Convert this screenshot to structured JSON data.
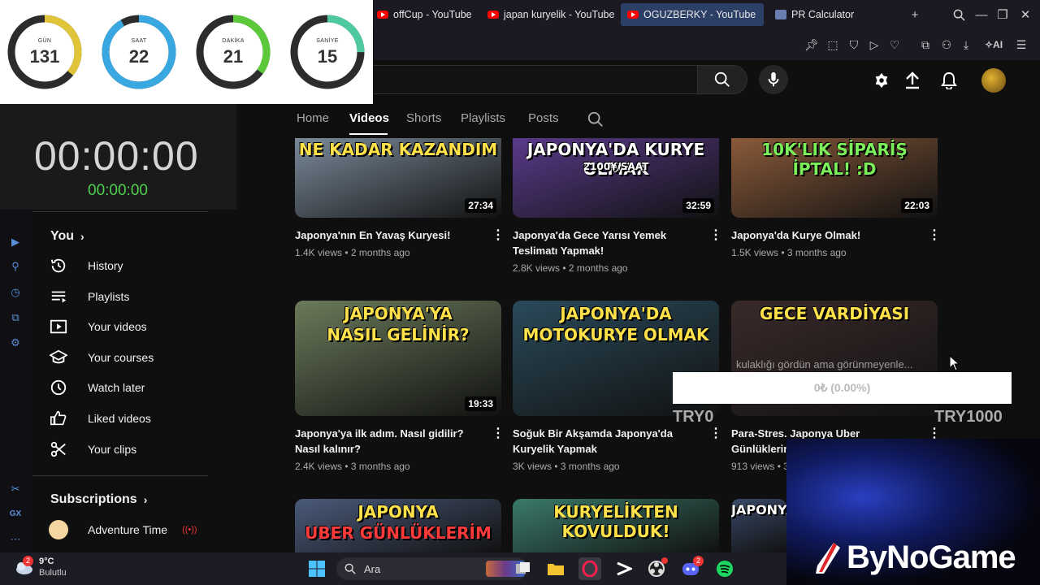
{
  "browser": {
    "tabs": [
      {
        "label": "offCup - YouTube",
        "active": false
      },
      {
        "label": "japan kuryelik - YouTube",
        "active": false
      },
      {
        "label": "OGUZBERKY - YouTube",
        "active": true
      },
      {
        "label": "PR Calculator",
        "active": false
      }
    ],
    "toolbar_ai_label": "AI"
  },
  "countdown": {
    "days": {
      "label": "GÜN",
      "value": "131",
      "color": "#e0c53a"
    },
    "hours": {
      "label": "SAAT",
      "value": "22",
      "color": "#3aa8e0"
    },
    "minutes": {
      "label": "DAKİKA",
      "value": "21",
      "color": "#5cc93a"
    },
    "seconds": {
      "label": "SANİYE",
      "value": "15",
      "color": "#4fc9a0"
    }
  },
  "stopwatch": {
    "main": "00:00:00",
    "sub": "00:00:00"
  },
  "channel_tabs": [
    "Home",
    "Videos",
    "Shorts",
    "Playlists",
    "Posts"
  ],
  "active_channel_tab": "Videos",
  "sidebar": {
    "you_label": "You",
    "items": [
      {
        "label": "History",
        "icon": "history-icon"
      },
      {
        "label": "Playlists",
        "icon": "playlists-icon"
      },
      {
        "label": "Your videos",
        "icon": "your-videos-icon"
      },
      {
        "label": "Your courses",
        "icon": "courses-icon"
      },
      {
        "label": "Watch later",
        "icon": "watch-later-icon"
      },
      {
        "label": "Liked videos",
        "icon": "like-icon"
      },
      {
        "label": "Your clips",
        "icon": "scissors-icon"
      }
    ],
    "subscriptions_label": "Subscriptions",
    "subscription": "Adventure Time",
    "rail_text": "GX"
  },
  "videos": [
    {
      "title": "Japonya'nın En Yavaş Kuryesi!",
      "meta": "1.4K views • 2 months ago",
      "duration": "27:34",
      "thumb_text": "NE KADAR KAZANDIM",
      "thumb_text_color": "#ffe14a",
      "bg": "#7a8a9a"
    },
    {
      "title": "Japonya'da Gece Yarısı Yemek Teslimatı Yapmak!",
      "meta": "2.8K views • 2 months ago",
      "duration": "32:59",
      "thumb_text": "JAPONYA'DA KURYE OLMAK",
      "thumb_text2": "2100¥/SAAT",
      "thumb_text_color": "#ffffff",
      "bg": "#5a3a8a"
    },
    {
      "title": "Japonya'da Kurye Olmak!",
      "meta": "1.5K views • 3 months ago",
      "duration": "22:03",
      "thumb_text": "10K'LIK SİPARİŞ İPTAL! :D",
      "thumb_text_color": "#7cf05a",
      "bg": "#8a5a3a"
    },
    {
      "title": "Japonya'ya ilk adım. Nasıl gidilir? Nasıl kalınır?",
      "meta": "2.4K views • 3 months ago",
      "duration": "19:33",
      "thumb_text": "JAPONYA'YA",
      "thumb_text2": "NASIL GELİNİR?",
      "thumb_text_color": "#ffe14a",
      "bg": "#6a7a5a"
    },
    {
      "title": "Soğuk Bir Akşamda Japonya'da Kuryelik Yapmak",
      "meta": "3K views • 3 months ago",
      "duration": "",
      "thumb_text": "JAPONYA'DA",
      "thumb_text2": "MOTOKURYE OLMAK",
      "thumb_text_color": "#ffe14a",
      "bg": "#2a4a5a"
    },
    {
      "title": "Para-Stres. Japonya Uber Günlüklerim",
      "meta": "913 views • 3",
      "duration": "",
      "thumb_text": "GECE VARDİYASI",
      "thumb_text_color": "#ffe14a",
      "bg": "#3a2a2a"
    },
    {
      "title": "",
      "meta": "",
      "duration": "",
      "thumb_text": "JAPONYA",
      "thumb_text2": "UBER GÜNLÜKLERİM",
      "thumb_text_color": "#ffe14a",
      "bg": "#4a5a7a"
    },
    {
      "title": "",
      "meta": "",
      "duration": "",
      "thumb_text": "KURYELİKTEN KOVULDUK!",
      "thumb_text_color": "#ffe14a",
      "bg": "#3a7a6a"
    },
    {
      "title": "",
      "meta": "",
      "duration": "",
      "thumb_text": "JAPONYA",
      "thumb_text_color": "#ffffff",
      "bg": "#3a4a6a"
    }
  ],
  "overlay": {
    "message": "kulaklığı gördün ama görünmeyenle...",
    "donation": "0₺ (0.00%)",
    "try_left": "TRY0",
    "try_right": "TRY1000",
    "brand": "ByNoGame"
  },
  "taskbar": {
    "weather_temp": "9°C",
    "weather_desc": "Bulutlu",
    "weather_badge": "2",
    "search_placeholder": "Ara",
    "discord_badge": "2"
  }
}
